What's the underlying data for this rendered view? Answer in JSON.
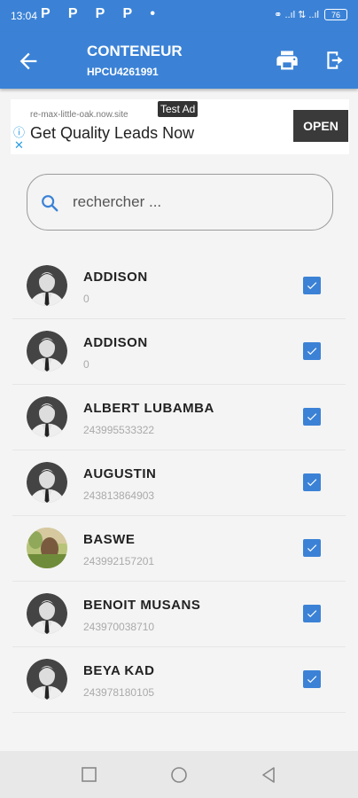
{
  "status_bar": {
    "time": "13:04",
    "app_icons": "P P P P •",
    "right_text": "⚭ ..ıl ⇅ ..ıl",
    "battery": "76"
  },
  "app_bar": {
    "title": "CONTENEUR",
    "subtitle": "HPCU4261991",
    "back_icon": "arrow-left-icon",
    "print_icon": "printer-icon",
    "export_icon": "exit-icon"
  },
  "ad": {
    "url": "re-max-little-oak.now.site",
    "tag": "Test Ad",
    "headline": "Get Quality Leads Now",
    "button": "OPEN",
    "info_icon": "ⓘ",
    "close_icon": "✕"
  },
  "search": {
    "placeholder": "rechercher ..."
  },
  "contacts": [
    {
      "name": "ADDISON",
      "phone": "0",
      "checked": true,
      "avatar": "person-silhouette-icon"
    },
    {
      "name": "ADDISON",
      "phone": "0",
      "checked": true,
      "avatar": "person-silhouette-icon"
    },
    {
      "name": "ALBERT LUBAMBA",
      "phone": "243995533322",
      "checked": true,
      "avatar": "person-silhouette-icon"
    },
    {
      "name": "AUGUSTIN",
      "phone": "243813864903",
      "checked": true,
      "avatar": "person-silhouette-icon"
    },
    {
      "name": "BASWE",
      "phone": "243992157201",
      "checked": true,
      "avatar": "photo"
    },
    {
      "name": "BENOIT MUSANS",
      "phone": "243970038710",
      "checked": true,
      "avatar": "person-silhouette-icon"
    },
    {
      "name": "BEYA KAD",
      "phone": "243978180105",
      "checked": true,
      "avatar": "person-silhouette-icon"
    }
  ],
  "colors": {
    "primary": "#3b82d6",
    "background": "#f4f4f4"
  }
}
